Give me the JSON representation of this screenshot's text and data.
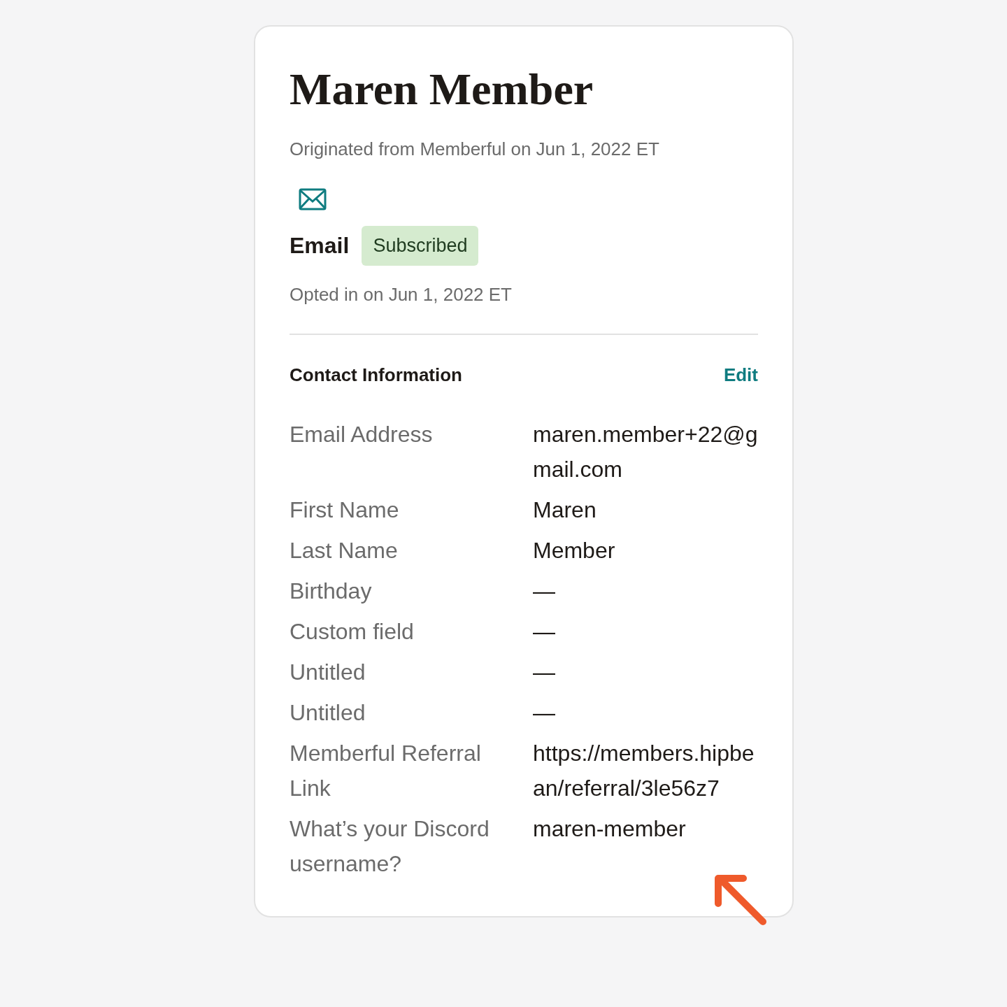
{
  "title": "Maren Member",
  "origin": "Originated from Memberful on Jun 1, 2022 ET",
  "email_status": {
    "label": "Email",
    "badge": "Subscribed",
    "opted_in": "Opted in on Jun 1, 2022 ET"
  },
  "contact": {
    "heading": "Contact Information",
    "edit": "Edit",
    "fields": [
      {
        "label": "Email Address",
        "value": "maren.member+22@gmail.com"
      },
      {
        "label": "First Name",
        "value": "Maren"
      },
      {
        "label": "Last Name",
        "value": "Member"
      },
      {
        "label": "Birthday",
        "value": "—"
      },
      {
        "label": "Custom field",
        "value": "—"
      },
      {
        "label": "Untitled",
        "value": "—"
      },
      {
        "label": "Untitled",
        "value": "—"
      },
      {
        "label": "Memberful Referral Link",
        "value": "https://members.hipbean/referral/3le56z7"
      },
      {
        "label": "What’s your Discord username?",
        "value": "maren-member"
      }
    ]
  }
}
